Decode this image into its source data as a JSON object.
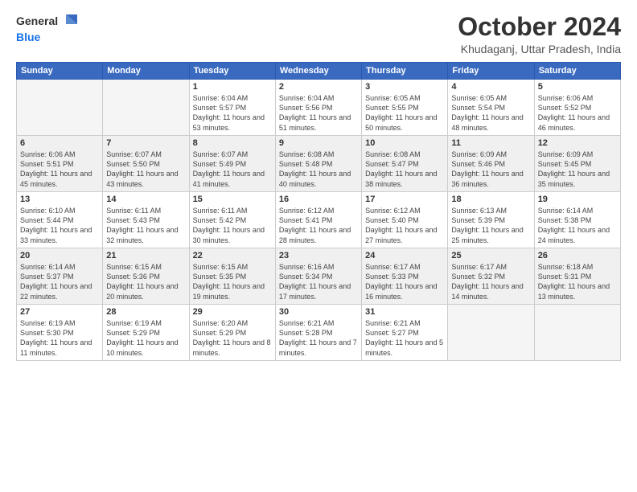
{
  "logo": {
    "general": "General",
    "blue": "Blue"
  },
  "header": {
    "title": "October 2024",
    "location": "Khudaganj, Uttar Pradesh, India"
  },
  "days_of_week": [
    "Sunday",
    "Monday",
    "Tuesday",
    "Wednesday",
    "Thursday",
    "Friday",
    "Saturday"
  ],
  "weeks": [
    [
      {
        "day": "",
        "detail": ""
      },
      {
        "day": "",
        "detail": ""
      },
      {
        "day": "1",
        "detail": "Sunrise: 6:04 AM\nSunset: 5:57 PM\nDaylight: 11 hours and 53 minutes."
      },
      {
        "day": "2",
        "detail": "Sunrise: 6:04 AM\nSunset: 5:56 PM\nDaylight: 11 hours and 51 minutes."
      },
      {
        "day": "3",
        "detail": "Sunrise: 6:05 AM\nSunset: 5:55 PM\nDaylight: 11 hours and 50 minutes."
      },
      {
        "day": "4",
        "detail": "Sunrise: 6:05 AM\nSunset: 5:54 PM\nDaylight: 11 hours and 48 minutes."
      },
      {
        "day": "5",
        "detail": "Sunrise: 6:06 AM\nSunset: 5:52 PM\nDaylight: 11 hours and 46 minutes."
      }
    ],
    [
      {
        "day": "6",
        "detail": "Sunrise: 6:06 AM\nSunset: 5:51 PM\nDaylight: 11 hours and 45 minutes."
      },
      {
        "day": "7",
        "detail": "Sunrise: 6:07 AM\nSunset: 5:50 PM\nDaylight: 11 hours and 43 minutes."
      },
      {
        "day": "8",
        "detail": "Sunrise: 6:07 AM\nSunset: 5:49 PM\nDaylight: 11 hours and 41 minutes."
      },
      {
        "day": "9",
        "detail": "Sunrise: 6:08 AM\nSunset: 5:48 PM\nDaylight: 11 hours and 40 minutes."
      },
      {
        "day": "10",
        "detail": "Sunrise: 6:08 AM\nSunset: 5:47 PM\nDaylight: 11 hours and 38 minutes."
      },
      {
        "day": "11",
        "detail": "Sunrise: 6:09 AM\nSunset: 5:46 PM\nDaylight: 11 hours and 36 minutes."
      },
      {
        "day": "12",
        "detail": "Sunrise: 6:09 AM\nSunset: 5:45 PM\nDaylight: 11 hours and 35 minutes."
      }
    ],
    [
      {
        "day": "13",
        "detail": "Sunrise: 6:10 AM\nSunset: 5:44 PM\nDaylight: 11 hours and 33 minutes."
      },
      {
        "day": "14",
        "detail": "Sunrise: 6:11 AM\nSunset: 5:43 PM\nDaylight: 11 hours and 32 minutes."
      },
      {
        "day": "15",
        "detail": "Sunrise: 6:11 AM\nSunset: 5:42 PM\nDaylight: 11 hours and 30 minutes."
      },
      {
        "day": "16",
        "detail": "Sunrise: 6:12 AM\nSunset: 5:41 PM\nDaylight: 11 hours and 28 minutes."
      },
      {
        "day": "17",
        "detail": "Sunrise: 6:12 AM\nSunset: 5:40 PM\nDaylight: 11 hours and 27 minutes."
      },
      {
        "day": "18",
        "detail": "Sunrise: 6:13 AM\nSunset: 5:39 PM\nDaylight: 11 hours and 25 minutes."
      },
      {
        "day": "19",
        "detail": "Sunrise: 6:14 AM\nSunset: 5:38 PM\nDaylight: 11 hours and 24 minutes."
      }
    ],
    [
      {
        "day": "20",
        "detail": "Sunrise: 6:14 AM\nSunset: 5:37 PM\nDaylight: 11 hours and 22 minutes."
      },
      {
        "day": "21",
        "detail": "Sunrise: 6:15 AM\nSunset: 5:36 PM\nDaylight: 11 hours and 20 minutes."
      },
      {
        "day": "22",
        "detail": "Sunrise: 6:15 AM\nSunset: 5:35 PM\nDaylight: 11 hours and 19 minutes."
      },
      {
        "day": "23",
        "detail": "Sunrise: 6:16 AM\nSunset: 5:34 PM\nDaylight: 11 hours and 17 minutes."
      },
      {
        "day": "24",
        "detail": "Sunrise: 6:17 AM\nSunset: 5:33 PM\nDaylight: 11 hours and 16 minutes."
      },
      {
        "day": "25",
        "detail": "Sunrise: 6:17 AM\nSunset: 5:32 PM\nDaylight: 11 hours and 14 minutes."
      },
      {
        "day": "26",
        "detail": "Sunrise: 6:18 AM\nSunset: 5:31 PM\nDaylight: 11 hours and 13 minutes."
      }
    ],
    [
      {
        "day": "27",
        "detail": "Sunrise: 6:19 AM\nSunset: 5:30 PM\nDaylight: 11 hours and 11 minutes."
      },
      {
        "day": "28",
        "detail": "Sunrise: 6:19 AM\nSunset: 5:29 PM\nDaylight: 11 hours and 10 minutes."
      },
      {
        "day": "29",
        "detail": "Sunrise: 6:20 AM\nSunset: 5:29 PM\nDaylight: 11 hours and 8 minutes."
      },
      {
        "day": "30",
        "detail": "Sunrise: 6:21 AM\nSunset: 5:28 PM\nDaylight: 11 hours and 7 minutes."
      },
      {
        "day": "31",
        "detail": "Sunrise: 6:21 AM\nSunset: 5:27 PM\nDaylight: 11 hours and 5 minutes."
      },
      {
        "day": "",
        "detail": ""
      },
      {
        "day": "",
        "detail": ""
      }
    ]
  ]
}
